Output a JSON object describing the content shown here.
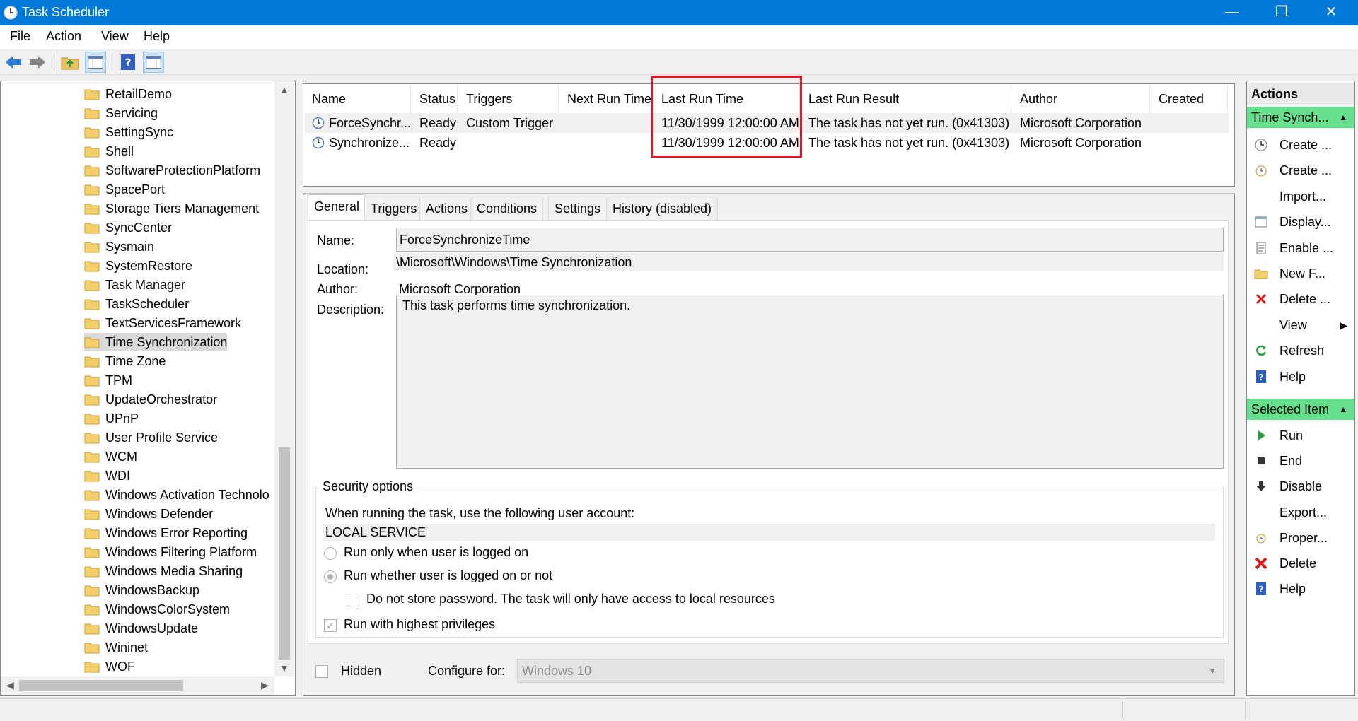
{
  "window": {
    "title": "Task Scheduler",
    "minimize": "—",
    "maximize": "❐",
    "close": "✕"
  },
  "menu": {
    "file": "File",
    "action": "Action",
    "view": "View",
    "help": "Help"
  },
  "tree": {
    "items": [
      "RetailDemo",
      "Servicing",
      "SettingSync",
      "Shell",
      "SoftwareProtectionPlatform",
      "SpacePort",
      "Storage Tiers Management",
      "SyncCenter",
      "Sysmain",
      "SystemRestore",
      "Task Manager",
      "TaskScheduler",
      "TextServicesFramework",
      "Time Synchronization",
      "Time Zone",
      "TPM",
      "UpdateOrchestrator",
      "UPnP",
      "User Profile Service",
      "WCM",
      "WDI",
      "Windows Activation Technolo",
      "Windows Defender",
      "Windows Error Reporting",
      "Windows Filtering Platform",
      "Windows Media Sharing",
      "WindowsBackup",
      "WindowsColorSystem",
      "WindowsUpdate",
      "Wininet",
      "WOF"
    ],
    "selected": "Time Synchronization"
  },
  "task_list": {
    "columns": [
      "Name",
      "Status",
      "Triggers",
      "Next Run Time",
      "Last Run Time",
      "Last Run Result",
      "Author",
      "Created"
    ],
    "rows": [
      {
        "name": "ForceSynchr...",
        "status": "Ready",
        "triggers": "Custom Trigger",
        "next_run": "",
        "last_run": "11/30/1999 12:00:00 AM",
        "result": "The task has not yet run. (0x41303)",
        "author": "Microsoft Corporation",
        "created": ""
      },
      {
        "name": "Synchronize...",
        "status": "Ready",
        "triggers": "",
        "next_run": "",
        "last_run": "11/30/1999 12:00:00 AM",
        "result": "The task has not yet run. (0x41303)",
        "author": "Microsoft Corporation",
        "created": ""
      }
    ]
  },
  "tabs": [
    "General",
    "Triggers",
    "Actions",
    "Conditions",
    "Settings",
    "History (disabled)"
  ],
  "general": {
    "name_label": "Name:",
    "name_value": "ForceSynchronizeTime",
    "location_label": "Location:",
    "location_value": "\\Microsoft\\Windows\\Time Synchronization",
    "author_label": "Author:",
    "author_value": "Microsoft Corporation",
    "description_label": "Description:",
    "description_value": "This task performs time synchronization."
  },
  "security": {
    "title": "Security options",
    "account_prompt": "When running the task, use the following user account:",
    "account": "LOCAL SERVICE",
    "radio_logged_on": "Run only when user is logged on",
    "radio_whether": "Run whether user is logged on or not",
    "no_store_password": "Do not store password.  The task will only have access to local resources",
    "highest_priv": "Run with highest privileges",
    "highest_priv_checked": true,
    "selected_radio": "whether"
  },
  "footer": {
    "hidden_label": "Hidden",
    "configure_label": "Configure for:",
    "configure_value": "Windows 10"
  },
  "actions_pane": {
    "header": "Actions",
    "group1": "Time Synch...",
    "group1_items": [
      "Create ...",
      "Create ...",
      "Import...",
      "Display...",
      "Enable ...",
      "New F...",
      "Delete ...",
      "View",
      "Refresh",
      "Help"
    ],
    "group2": "Selected Item",
    "group2_items": [
      "Run",
      "End",
      "Disable",
      "Export...",
      "Proper...",
      "Delete",
      "Help"
    ]
  },
  "colors": {
    "titlebar": "#0078d7",
    "group_header": "#66e08d",
    "highlight_box": "#e81123"
  }
}
